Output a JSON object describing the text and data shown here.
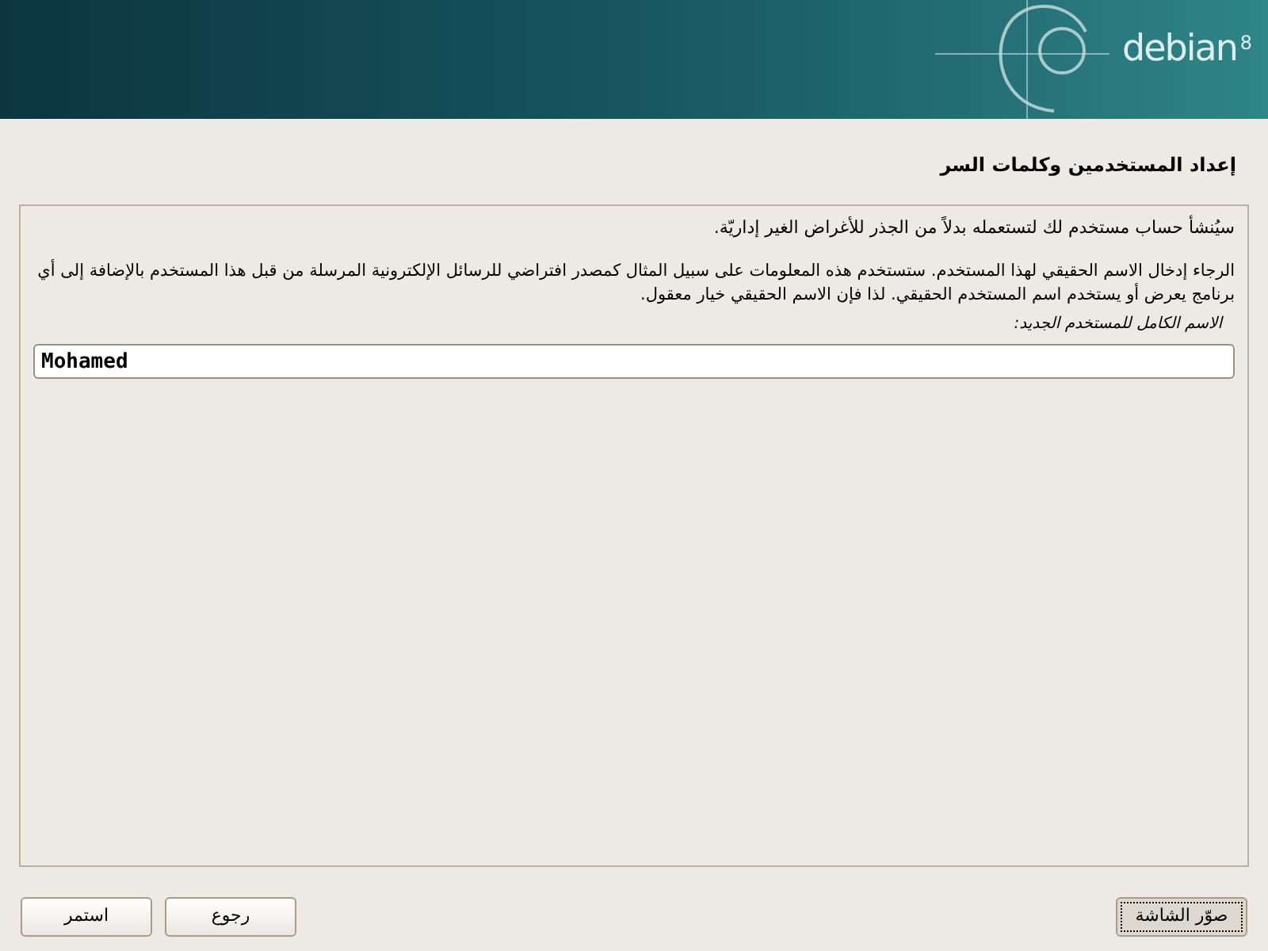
{
  "banner": {
    "logo": "debian",
    "version": "8"
  },
  "page_title": "إعداد المستخدمين وكلمات السر",
  "intro": "سيُنشأ حساب مستخدم لك لتستعمله بدلاً من الجذر للأغراض الغير إداريّة.",
  "description": "الرجاء إدخال الاسم الحقيقي لهذا المستخدم. ستستخدم هذه المعلومات على سبيل المثال كمصدر افتراضي للرسائل الإلكترونية المرسلة من قبل هذا المستخدم بالإضافة إلى أي برنامج يعرض أو يستخدم اسم المستخدم الحقيقي. لذا فإن الاسم الحقيقي خيار معقول.",
  "field": {
    "label": "الاسم الكامل للمستخدم الجديد:",
    "value": "Mohamed"
  },
  "buttons": [
    {
      "label": "صوّر الشاشة",
      "focused": true
    },
    {
      "label": "رجوع",
      "focused": false
    },
    {
      "label": "استمر",
      "focused": false
    }
  ]
}
